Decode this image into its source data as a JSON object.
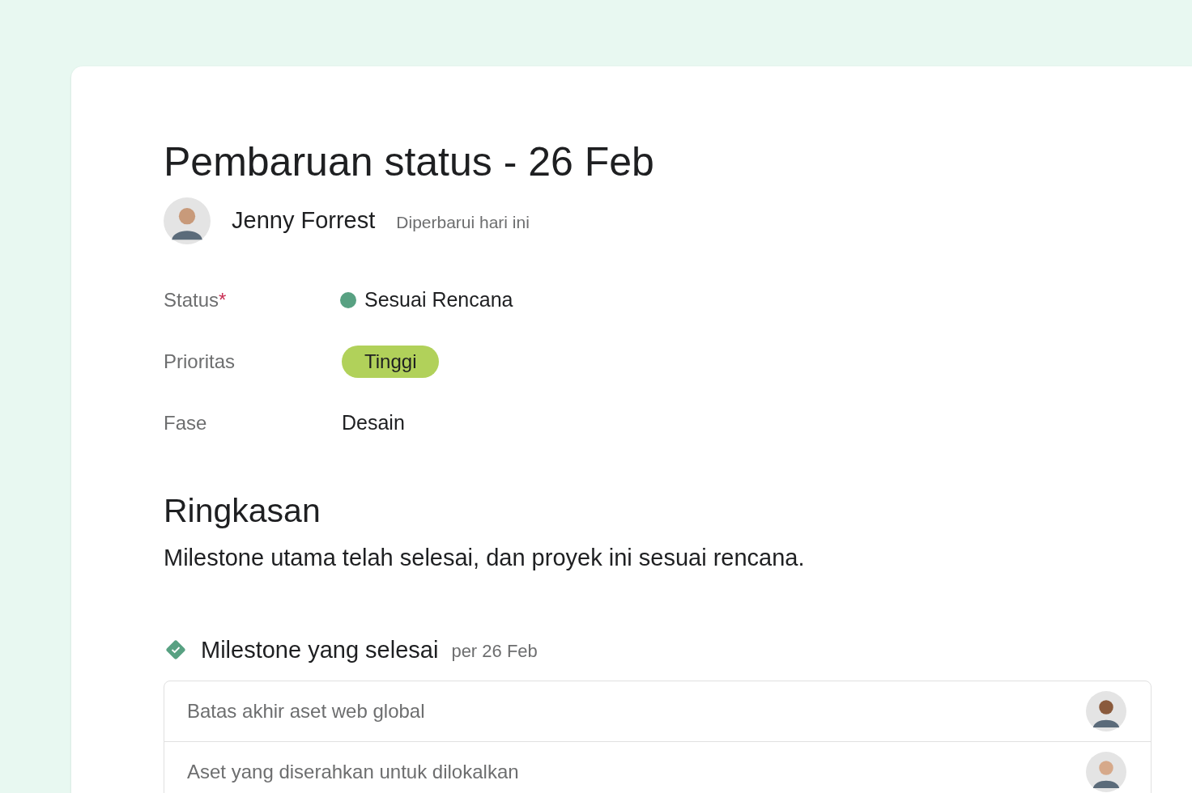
{
  "title": "Pembaruan status - 26 Feb",
  "author": {
    "name": "Jenny Forrest",
    "updated": "Diperbarui hari ini"
  },
  "fields": [
    {
      "kind": "status",
      "label": "Status",
      "required_mark": "*",
      "value": "Sesuai Rencana",
      "color": "#58a182"
    },
    {
      "kind": "tag",
      "label": "Prioritas",
      "value": "Tinggi",
      "color": "#b1d15a"
    },
    {
      "kind": "text",
      "label": "Fase",
      "value": "Desain"
    }
  ],
  "summary": {
    "heading": "Ringkasan",
    "text": "Milestone utama telah selesai, dan proyek ini sesuai rencana."
  },
  "milestones": {
    "heading": "Milestone yang selesai",
    "date": "per 26 Feb",
    "items": [
      {
        "title": "Batas akhir aset web global"
      },
      {
        "title": "Aset yang diserahkan untuk dilokalkan"
      }
    ]
  }
}
